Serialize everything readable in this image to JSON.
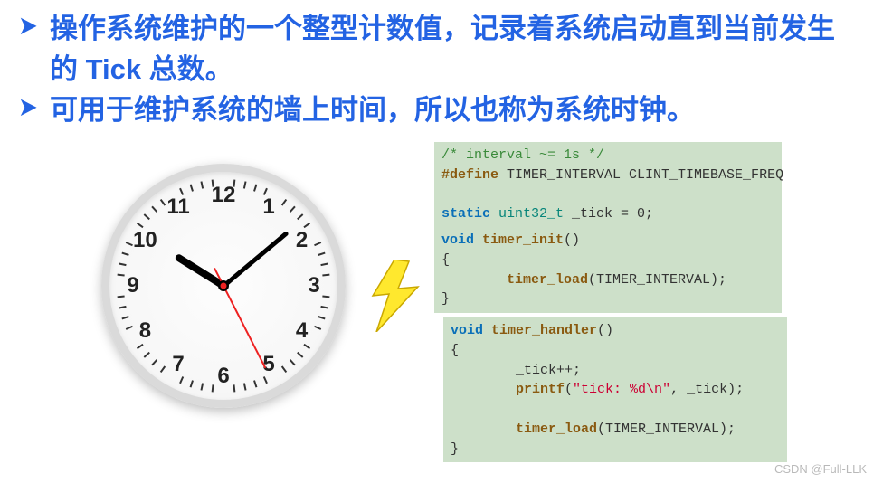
{
  "bullets": {
    "b1": "操作系统维护的一个整型计数值，记录着系统启动直到当前发生的 Tick 总数。",
    "b2": "可用于维护系统的墙上时间，所以也称为系统时钟。"
  },
  "clock": {
    "numbers": [
      "12",
      "1",
      "2",
      "3",
      "4",
      "5",
      "6",
      "7",
      "8",
      "9",
      "10",
      "11"
    ],
    "hour_angle": 302,
    "minute_angle": 50,
    "second_angle": 153
  },
  "code1": {
    "c": "/* interval ~= 1s */",
    "d1": "#define",
    "d2": " TIMER_INTERVAL CLINT_TIMEBASE_FREQ",
    "s1": "static ",
    "s2": "uint32_t",
    "s3": " _tick = 0;"
  },
  "code2": {
    "l1a": "void ",
    "l1b": "timer_init",
    "l1c": "()",
    "l2": "{",
    "l3a": "        ",
    "l3b": "timer_load",
    "l3c": "(TIMER_INTERVAL);",
    "l4": "}"
  },
  "code3": {
    "l1a": "void ",
    "l1b": "timer_handler",
    "l1c": "()",
    "l2": "{",
    "l3": "        _tick++;",
    "l4a": "        ",
    "l4b": "printf",
    "l4c": "(",
    "l4d": "\"tick: %d\\n\"",
    "l4e": ", _tick);",
    "l5": "",
    "l6a": "        ",
    "l6b": "timer_load",
    "l6c": "(TIMER_INTERVAL);",
    "l7": "}"
  },
  "watermark": "CSDN @Full-LLK"
}
